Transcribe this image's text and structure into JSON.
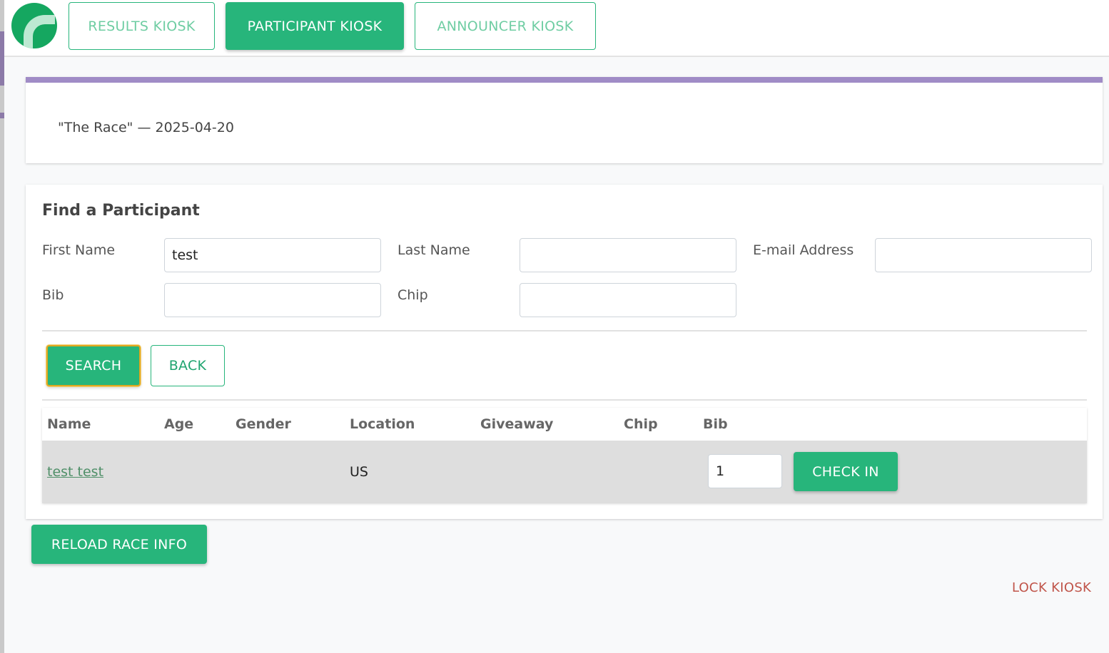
{
  "nav": {
    "tabs": [
      {
        "label": "RESULTS KIOSK",
        "active": false
      },
      {
        "label": "PARTICIPANT KIOSK",
        "active": true
      },
      {
        "label": "ANNOUNCER KIOSK",
        "active": false
      }
    ]
  },
  "race": {
    "title": "\"The Race\" — 2025-04-20"
  },
  "find": {
    "title": "Find a Participant",
    "first_name": {
      "label": "First Name",
      "value": "test"
    },
    "last_name": {
      "label": "Last Name",
      "value": ""
    },
    "email": {
      "label": "E-mail Address",
      "value": ""
    },
    "bib": {
      "label": "Bib",
      "value": ""
    },
    "chip": {
      "label": "Chip",
      "value": ""
    },
    "search_label": "SEARCH",
    "back_label": "BACK"
  },
  "results": {
    "columns": [
      "Name",
      "Age",
      "Gender",
      "Location",
      "Giveaway",
      "Chip",
      "Bib"
    ],
    "rows": [
      {
        "name": "test test",
        "age": "",
        "gender": "",
        "location": "US",
        "giveaway": "",
        "chip": "",
        "bib": "1",
        "action": "CHECK IN"
      }
    ]
  },
  "footer": {
    "reload_label": "RELOAD RACE INFO",
    "lock_label": "LOCK KIOSK"
  },
  "colors": {
    "accent": "#27b57b",
    "header_stripe": "#a08cc6",
    "lock_text": "#c0554a",
    "focus_ring": "#e0a820"
  }
}
